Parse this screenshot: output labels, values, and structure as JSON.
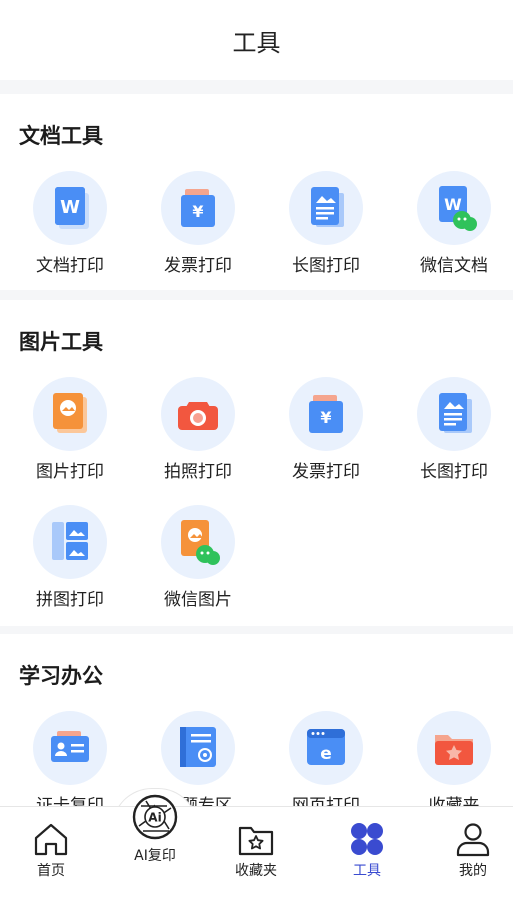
{
  "header": {
    "title": "工具"
  },
  "sections": [
    {
      "title": "文档工具",
      "tools": [
        {
          "label": "文档打印",
          "icon": "word-doc-icon"
        },
        {
          "label": "发票打印",
          "icon": "invoice-icon"
        },
        {
          "label": "长图打印",
          "icon": "long-image-icon"
        },
        {
          "label": "微信文档",
          "icon": "wechat-doc-icon"
        }
      ]
    },
    {
      "title": "图片工具",
      "tools": [
        {
          "label": "图片打印",
          "icon": "image-print-icon"
        },
        {
          "label": "拍照打印",
          "icon": "camera-icon"
        },
        {
          "label": "发票打印",
          "icon": "invoice-icon"
        },
        {
          "label": "长图打印",
          "icon": "long-image-icon"
        },
        {
          "label": "拼图打印",
          "icon": "collage-icon"
        },
        {
          "label": "微信图片",
          "icon": "wechat-image-icon"
        }
      ]
    },
    {
      "title": "学习办公",
      "tools": [
        {
          "label": "证卡复印",
          "icon": "id-card-icon"
        },
        {
          "label": "错题专区",
          "icon": "error-book-icon"
        },
        {
          "label": "网页打印",
          "icon": "web-page-icon"
        },
        {
          "label": "收藏夹",
          "icon": "favorites-folder-icon"
        }
      ]
    }
  ],
  "tabbar": {
    "items": [
      {
        "label": "首页",
        "icon": "home-icon"
      },
      {
        "label": "AI复印",
        "icon": "ai-aperture-icon"
      },
      {
        "label": "收藏夹",
        "icon": "star-folder-icon"
      },
      {
        "label": "工具",
        "icon": "four-circles-icon",
        "active": true
      },
      {
        "label": "我的",
        "icon": "user-icon"
      }
    ]
  },
  "colors": {
    "accent": "#3a4bd0",
    "icon_blue": "#4a8ef5",
    "icon_orange": "#f5923a",
    "icon_red": "#f2573f",
    "circle_bg": "#e9f1fd",
    "wechat_green": "#2fc25b"
  }
}
